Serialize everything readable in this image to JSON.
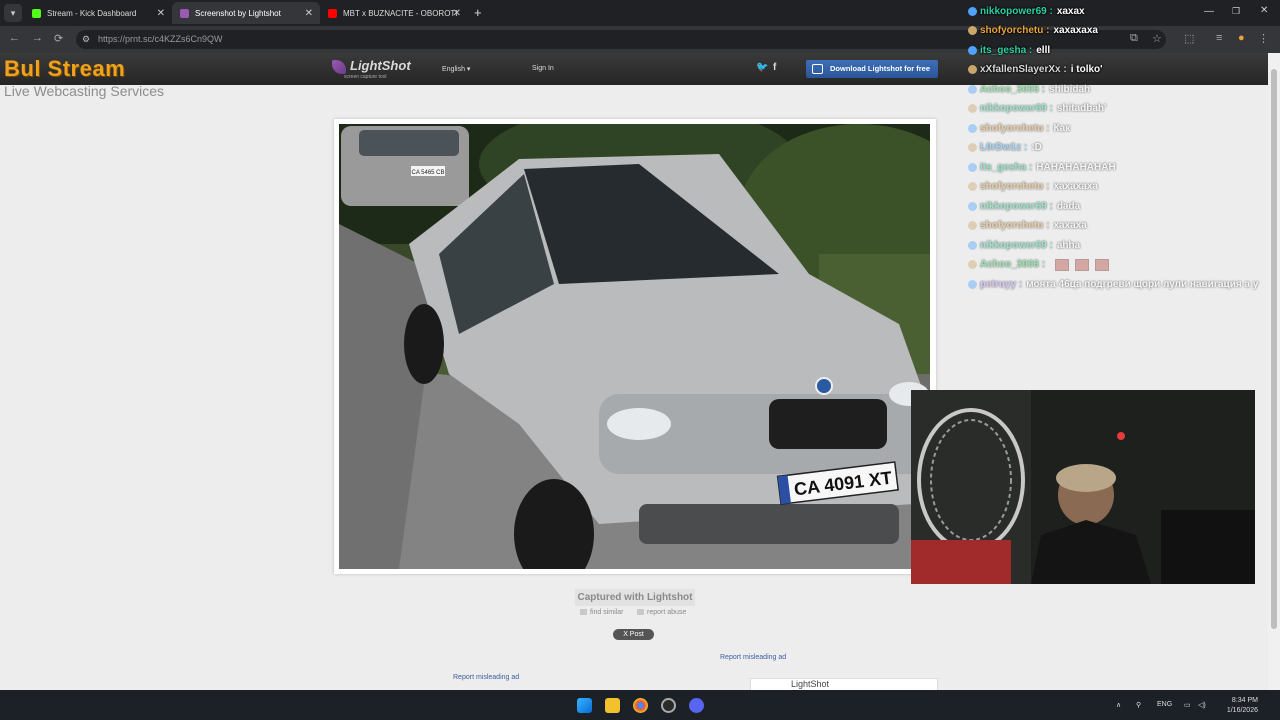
{
  "browser": {
    "tabs": [
      {
        "title": "Stream - Kick Dashboard",
        "active": false,
        "favicon_color": "#53fc18"
      },
      {
        "title": "Screenshot by Lightshot",
        "active": true,
        "favicon_color": "#9b59b6"
      },
      {
        "title": "MBT x BUZNACITE - OBOROTI",
        "active": false,
        "favicon_color": "#ff0000"
      }
    ],
    "url": "https://prnt.sc/c4KZZs6Cn9QW"
  },
  "site": {
    "brand_logo": "Bul Stream",
    "brand_tagline": "Live Webcasting Services",
    "lightshot_logo": "LightShot",
    "lightshot_sub": "screen capture tool",
    "language": "English",
    "sign_in": "Sign In",
    "download_button": "Download Lightshot for free",
    "captured_label": "Captured with Lightshot",
    "find_similar": "find similar",
    "report_abuse": "report abuse",
    "x_post": "X Post",
    "report_ad_1": "Report misleading ad",
    "report_ad_2": "Report misleading ad",
    "ad_title": "LightShot",
    "plate_text": "CA 4091 XT",
    "rear_plate_text": "CA 5465 CB"
  },
  "chat": {
    "messages": [
      {
        "user": "nikkopower69",
        "text": "xaxax",
        "color": "#2ad3a0",
        "dim": false
      },
      {
        "user": "shofyorchetu",
        "text": "xaxaxaxa",
        "color": "#e8a33d",
        "dim": false
      },
      {
        "user": "its_gesha",
        "text": "elll",
        "color": "#2ad3a0",
        "dim": false
      },
      {
        "user": "xXfallenSlayerXx",
        "text": "i tolko'",
        "color": "#d7d7d7",
        "dim": false
      },
      {
        "user": "Achoo_3006",
        "text": "shibidah",
        "color": "#2ad35b",
        "dim": true
      },
      {
        "user": "nikkopower69",
        "text": "shitadbah'",
        "color": "#2ad3a0",
        "dim": true
      },
      {
        "user": "shofyorchetu",
        "text": "Как",
        "color": "#e8a33d",
        "dim": true
      },
      {
        "user": "L0rDw1z",
        "text": ":D",
        "color": "#3db0ff",
        "dim": true
      },
      {
        "user": "its_gesha",
        "text": "HAHAHAHAHAH",
        "color": "#2ad3a0",
        "dim": true
      },
      {
        "user": "shofyorchetu",
        "text": "xaxaxaxa",
        "color": "#e8a33d",
        "dim": true
      },
      {
        "user": "nikkopower69",
        "text": "dada",
        "color": "#2ad3a0",
        "dim": true
      },
      {
        "user": "shofyorchetu",
        "text": "xaxaxa",
        "color": "#e8a33d",
        "dim": true
      },
      {
        "user": "nikkopower69",
        "text": "ahha",
        "color": "#2ad3a0",
        "dim": true
      },
      {
        "user": "Achoo_3006",
        "text": "",
        "color": "#2ad35b",
        "dim": true,
        "emotes": 3
      },
      {
        "user": "petruyy",
        "text": "моята 46ца подгреви щори лули навигация а у",
        "color": "#b690ff",
        "dim": true
      }
    ]
  },
  "taskbar": {
    "lang": "ENG",
    "time": "8:34 PM",
    "date": "1/16/2026"
  }
}
